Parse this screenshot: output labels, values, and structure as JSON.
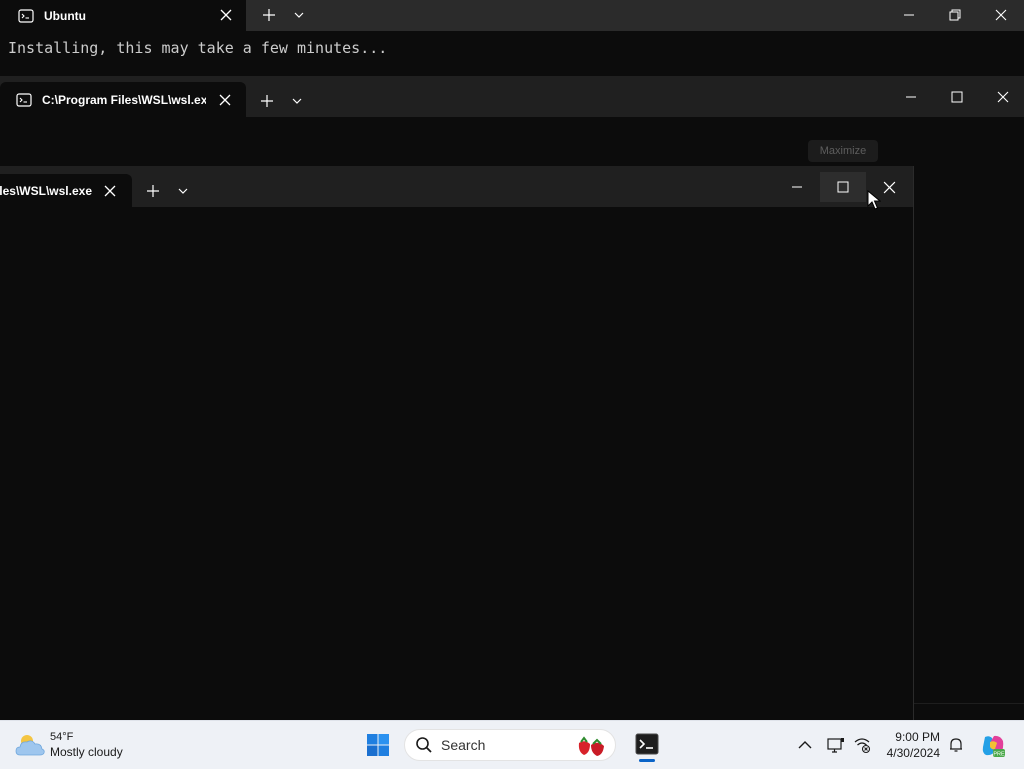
{
  "windows": [
    {
      "tab": {
        "icon": "terminal-icon",
        "label": "Ubuntu"
      },
      "console_text": "Installing, this may take a few minutes...",
      "controls": [
        "minimize",
        "restore",
        "close"
      ]
    },
    {
      "tab": {
        "icon": "terminal-icon",
        "label": "C:\\Program Files\\WSL\\wsl.exe"
      },
      "controls": [
        "minimize",
        "maximize",
        "close"
      ]
    },
    {
      "tab": {
        "icon": "terminal-icon",
        "label": "C:\\Program Files\\WSL\\wsl.exe"
      },
      "controls": [
        "minimize",
        "maximize",
        "close"
      ]
    }
  ],
  "tooltip": {
    "text": "Maximize"
  },
  "taskbar": {
    "weather": {
      "temp": "54°F",
      "condition": "Mostly cloudy",
      "icon": "cloud-icon"
    },
    "start_icon": "windows-logo-icon",
    "search": {
      "placeholder": "Search",
      "icon": "search-icon"
    },
    "pinned": [
      {
        "name": "Terminal",
        "icon": "terminal-icon",
        "active": true
      }
    ],
    "tray": {
      "icons": [
        "chevron-up-icon",
        "display-icon",
        "network-icon",
        "bell-icon",
        "copilot-icon"
      ],
      "time": "9:00 PM",
      "date": "4/30/2024"
    }
  },
  "colors": {
    "terminal_bg": "#0c0c0c",
    "taskbar_bg": "#eef1f6",
    "accent": "#0a64c8"
  }
}
